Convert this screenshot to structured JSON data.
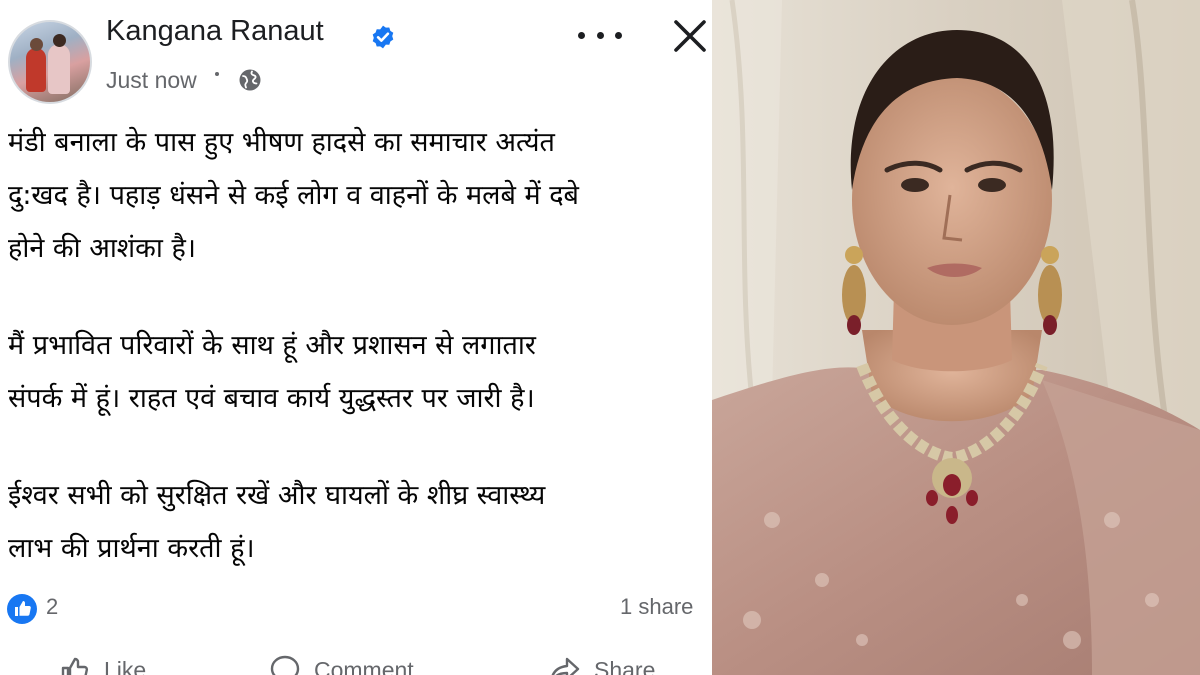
{
  "post": {
    "author_name": "Kangana Ranaut",
    "timestamp": "Just now",
    "icons": {
      "avatar": "profile-photo",
      "verified": "verified-badge-icon",
      "audience": "globe-icon",
      "more": "more-options-icon",
      "close": "close-icon",
      "reaction": "like-reaction-icon"
    },
    "paragraphs": [
      {
        "lines": [
          "मंडी बनाला के पास हुए भीषण हादसे का समाचार अत्यंत",
          "दु:खद है। पहाड़ धंसने से कई लोग व वाहनों के मलबे में दबे",
          "होने की आशंका है।"
        ]
      },
      {
        "lines": [
          "मैं प्रभावित परिवारों के साथ हूं और प्रशासन से लगातार",
          "संपर्क में हूं। राहत एवं बचाव कार्य युद्धस्तर पर जारी है।"
        ]
      },
      {
        "lines": [
          "ईश्वर सभी को सुरक्षित रखें और घायलों के शीघ्र स्वास्थ्य",
          "लाभ की प्रार्थना करती हूं।"
        ]
      }
    ],
    "reaction_count": "2",
    "shares_text": "1 share",
    "actions": [
      {
        "label": "Like",
        "icon": "thumbs-up-icon"
      },
      {
        "label": "Comment",
        "icon": "comment-icon"
      },
      {
        "label": "Share",
        "icon": "share-icon"
      }
    ]
  },
  "colors": {
    "verified": "#1877f2",
    "meta_text": "#65676b",
    "body_text": "#050505"
  }
}
